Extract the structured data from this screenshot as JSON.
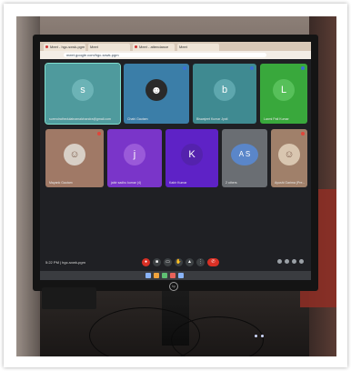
{
  "browser": {
    "tabs": [
      {
        "label": "Meet - hgc-sxwk-pgm"
      },
      {
        "label": "Meet"
      },
      {
        "label": "Meet - attendance"
      },
      {
        "label": "Meet"
      }
    ],
    "address": "meet.google.com/hgc-sxwk-pgm"
  },
  "participants": [
    {
      "initial": "s",
      "name": "surendrathedulatnamalchandra@gmail.com",
      "color": "#4f9a9d",
      "active": true,
      "mic_muted": false
    },
    {
      "initial": "",
      "name": "Chahi Gautam",
      "color": "#3b7ea8",
      "active": false,
      "mic_muted": false,
      "photo": true
    },
    {
      "initial": "b",
      "name": "Biswajeet Kumar Jyoti",
      "color": "#3f8a91",
      "active": false,
      "mic_muted": false
    },
    {
      "initial": "L",
      "name": "Laxmi Pati Kumar",
      "color": "#39a83c",
      "active": false,
      "mic_muted": false
    },
    {
      "initial": "",
      "name": "Mayank Gautam",
      "color": "#a07966",
      "active": false,
      "mic_muted": true,
      "photo": true
    },
    {
      "initial": "j",
      "name": "jabir sadhu kumar (4)",
      "color": "#7a35c9",
      "active": false,
      "mic_muted": false
    },
    {
      "initial": "K",
      "name": "Kabir Kumar",
      "color": "#5e22c6",
      "active": false,
      "mic_muted": false
    },
    {
      "initial": "A S",
      "name": "2 others",
      "color": "#6a6e73",
      "active": false,
      "mic_muted": false
    },
    {
      "initial": "",
      "name": "Ayushi Garima (Pre...",
      "color": "#a0806a",
      "active": false,
      "mic_muted": true,
      "photo": true
    }
  ],
  "toolbar": {
    "time": "5:22 PM | hgc-sxwk-pgm",
    "controls": [
      "mic",
      "camera",
      "captions",
      "raise-hand",
      "present",
      "more",
      "end-call"
    ]
  },
  "colors": {
    "screen_bg": "#1f2024",
    "end_call": "#d93025",
    "active_outline": "#7fe0d0"
  }
}
